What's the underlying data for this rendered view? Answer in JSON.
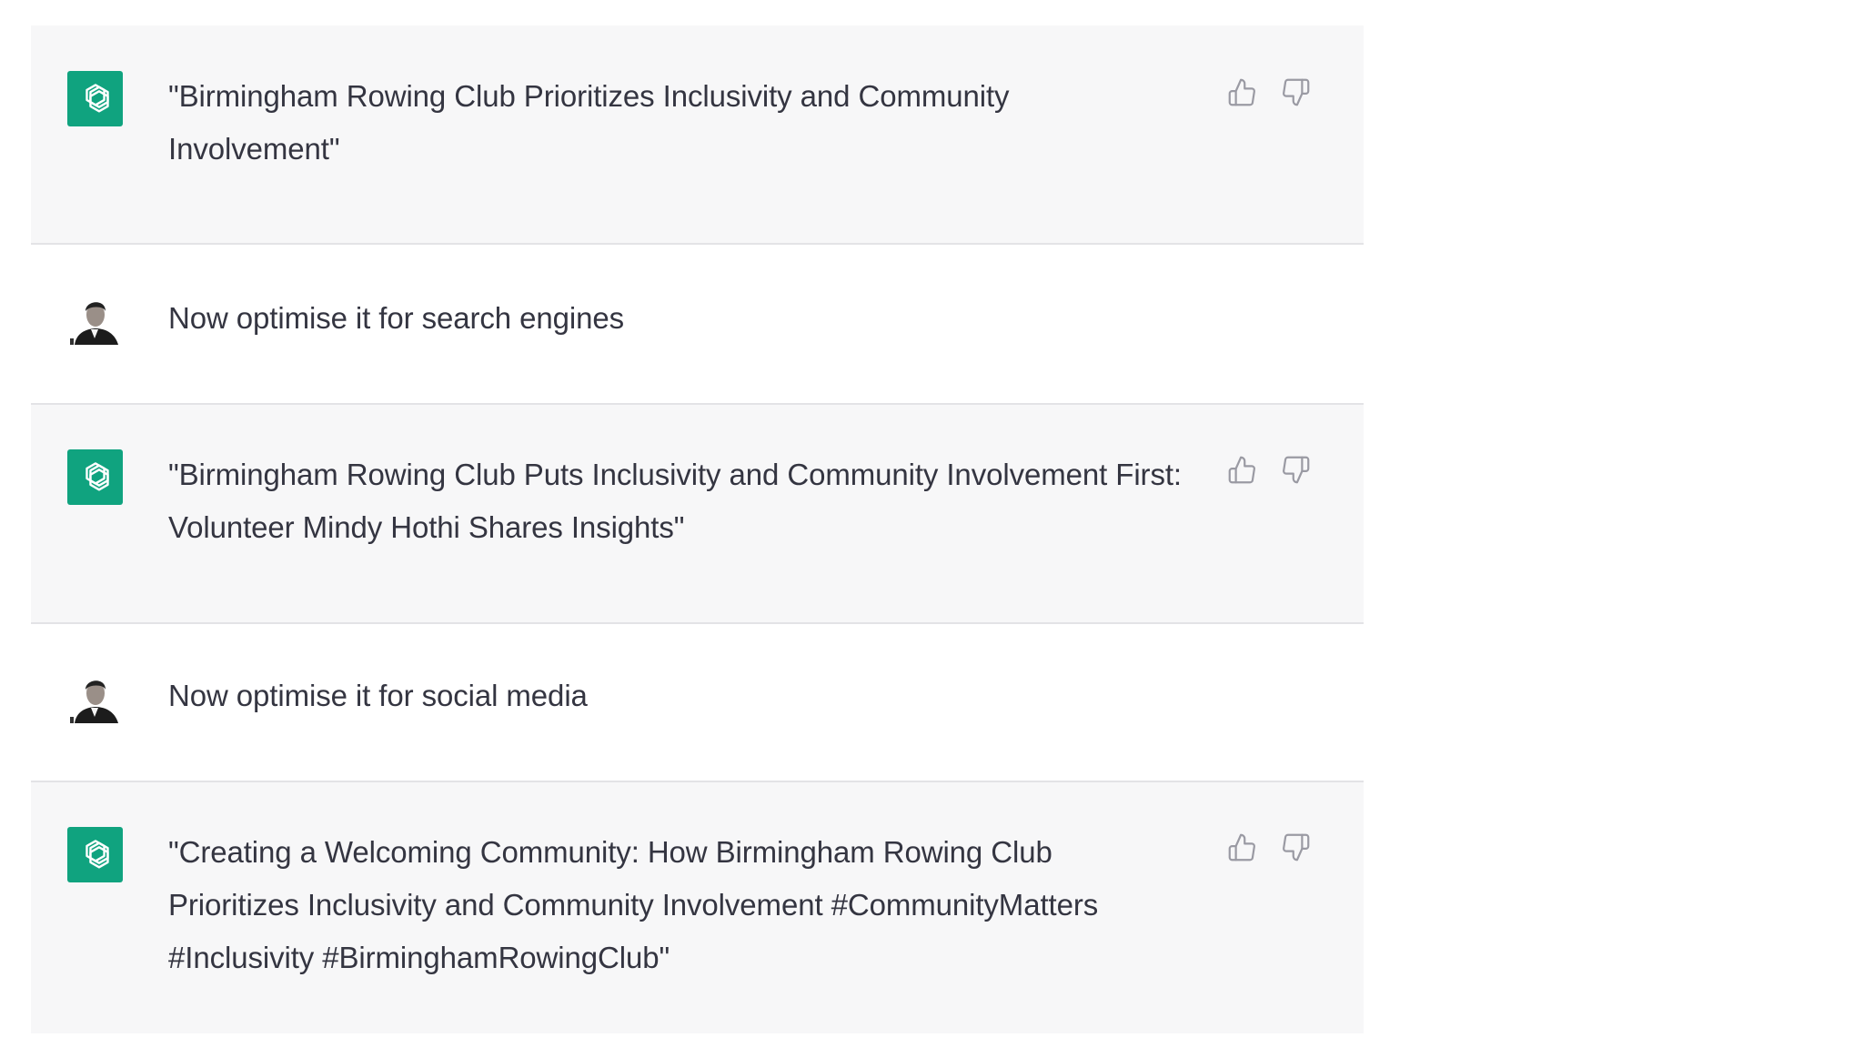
{
  "conversation": {
    "messages": [
      {
        "role": "assistant",
        "text": "\"Birmingham Rowing Club Prioritizes Inclusivity and Community Involvement\"",
        "avatar_icon": "openai-logo-icon"
      },
      {
        "role": "user",
        "text": "Now optimise it for search engines",
        "avatar_icon": "user-photo-avatar"
      },
      {
        "role": "assistant",
        "text": "\"Birmingham Rowing Club Puts Inclusivity and Community Involvement First: Volunteer Mindy Hothi Shares Insights\"",
        "avatar_icon": "openai-logo-icon"
      },
      {
        "role": "user",
        "text": "Now optimise it for social media",
        "avatar_icon": "user-photo-avatar"
      },
      {
        "role": "assistant",
        "text": "\"Creating a Welcoming Community: How Birmingham Rowing Club Prioritizes Inclusivity and Community Involvement #CommunityMatters #Inclusivity #BirminghamRowingClub\"",
        "avatar_icon": "openai-logo-icon"
      }
    ],
    "feedback_icons": [
      "thumbs-up-icon",
      "thumbs-down-icon"
    ]
  },
  "colors": {
    "assistant_bg": "#f7f7f8",
    "user_bg": "#ffffff",
    "brand_green": "#10a37f",
    "text": "#343541",
    "icon": "#9a9aa3",
    "divider": "#e3e3e6"
  }
}
